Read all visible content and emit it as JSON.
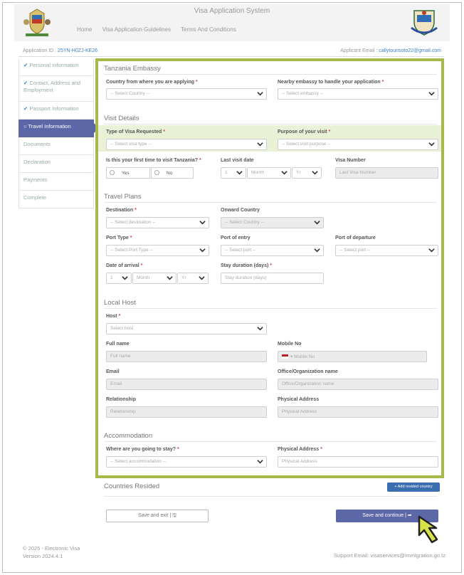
{
  "header": {
    "title": "Visa Application System",
    "nav": [
      "Home",
      "Visa Application Guidelines",
      "Terms And Conditions"
    ]
  },
  "infobar": {
    "app_id_label": "Application ID :",
    "app_id": "25YN-H0ZJ-KE26",
    "email_label": "Applicant Email :",
    "email": "callytourisoto22@gmail.com"
  },
  "sidebar": {
    "items": [
      {
        "label": "Personal Information",
        "done": true
      },
      {
        "label": "Contact, Address and Employment",
        "done": true
      },
      {
        "label": "Passport Information",
        "done": true
      },
      {
        "label": "Travel Information",
        "active": true
      },
      {
        "label": "Documents"
      },
      {
        "label": "Declaration"
      },
      {
        "label": "Payments"
      },
      {
        "label": "Complete"
      }
    ]
  },
  "sections": {
    "embassy": "Tanzania Embassy",
    "visit": "Visit Details",
    "travel": "Travel Plans",
    "host": "Local Host",
    "accommodation": "Accommodation",
    "countries": "Countries Resided"
  },
  "fields": {
    "country_applying": {
      "label": "Country from where you are applying",
      "placeholder": "-- Select Country --"
    },
    "nearby_embassy": {
      "label": "Nearby embassy to handle your application",
      "placeholder": "-- Select embassy --"
    },
    "visa_type": {
      "label": "Type of Visa Requested",
      "placeholder": "-- Select visa type --"
    },
    "purpose": {
      "label": "Purpose of your visit",
      "placeholder": "-- Select visit purpose --"
    },
    "first_time": {
      "label": "Is this your first time to visit Tanzania?",
      "yes": "Yes",
      "no": "No"
    },
    "last_visit": {
      "label": "Last visit date",
      "day": "1",
      "month": "Month",
      "year": "Yr"
    },
    "visa_number": {
      "label": "Visa Number",
      "placeholder": "Last Visa Number"
    },
    "destination": {
      "label": "Destination",
      "placeholder": "-- Select destination --"
    },
    "onward_country": {
      "label": "Onward Country",
      "placeholder": "-- Select Country --"
    },
    "port_type": {
      "label": "Port Type",
      "placeholder": "-- Select Port Type --"
    },
    "port_entry": {
      "label": "Port of entry",
      "placeholder": "-- Select port --"
    },
    "port_departure": {
      "label": "Port of departure",
      "placeholder": "-- Select port --"
    },
    "arrival_date": {
      "label": "Date of arrival",
      "day": "1",
      "month": "Month",
      "year": "Yr"
    },
    "stay_duration": {
      "label": "Stay duration (days)",
      "placeholder": "Stay duration (days)"
    },
    "host": {
      "label": "Host",
      "placeholder": "Select host"
    },
    "full_name": {
      "label": "Full name",
      "placeholder": "Full name"
    },
    "mobile": {
      "label": "Mobile No",
      "placeholder": "Mobile No"
    },
    "email": {
      "label": "Email",
      "placeholder": "Email"
    },
    "office": {
      "label": "Office/Organization name",
      "placeholder": "Office/Organization name"
    },
    "relationship": {
      "label": "Relationship",
      "placeholder": "Relationship"
    },
    "physical_address_host": {
      "label": "Physical Address",
      "placeholder": "Physical Address"
    },
    "stay_where": {
      "label": "Where are you going to stay?",
      "placeholder": "-- Select accommodation --"
    },
    "physical_address_acc": {
      "label": "Physical Address",
      "placeholder": "Physical Address"
    }
  },
  "buttons": {
    "add_country": "+ Add resided country",
    "save_exit": "Save and exit | 🖫",
    "save_continue": "Save and continue | ➦"
  },
  "footer": {
    "copyright": "© 2025 - Electronic Visa",
    "version": "Version 2024.4.1",
    "support": "Support Email: visaservices@immigration.go.tz"
  },
  "colors": {
    "accent": "#5c67a8",
    "highlight_border": "#a8b84a",
    "highlight_band": "#e9f1d6",
    "link": "#3b82c4"
  }
}
